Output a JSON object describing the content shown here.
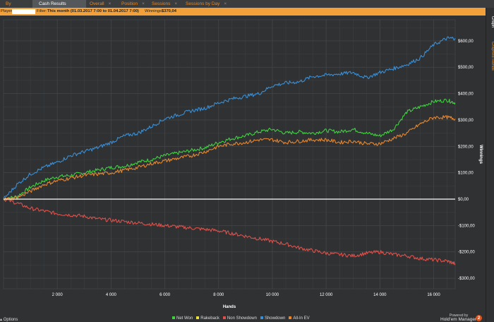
{
  "tabs": [
    {
      "label": "By Stakes",
      "active": false
    },
    {
      "label": "Cash Results Graph",
      "active": true
    },
    {
      "label": "Overall",
      "active": false
    },
    {
      "label": "Position",
      "active": false
    },
    {
      "label": "Sessions",
      "active": false
    },
    {
      "label": "Sessions by Day",
      "active": false
    }
  ],
  "tab_close_glyph": "×",
  "filter": {
    "player_label": "Player:",
    "player_value": "",
    "filter_label": "Filter:",
    "filter_value": "This month (01.03.2017 7:00 to 01.04.2017 7:00)",
    "winnings_label": "Winnings:",
    "winnings_value": "$370,04"
  },
  "sidebar": {
    "graph_label": "Graph",
    "graphed_hands_label": "Graphed Hands"
  },
  "footer": {
    "options_label": "Options",
    "powered_by": "Powered by",
    "brand": "Hold'em Manager",
    "brand_logo": "2"
  },
  "colors": {
    "background": "#2f3133",
    "grid": "#434648",
    "zero_line": "#ffffff",
    "accent": "#f2a13a"
  },
  "chart_data": {
    "type": "line",
    "xlabel": "Hands",
    "ylabel": "Winnings",
    "xlim": [
      0,
      16800
    ],
    "ylim": [
      -340,
      680
    ],
    "x_ticks": [
      {
        "v": 2000,
        "label": "2 000"
      },
      {
        "v": 4000,
        "label": "4 000"
      },
      {
        "v": 6000,
        "label": "6 000"
      },
      {
        "v": 8000,
        "label": "8 000"
      },
      {
        "v": 10000,
        "label": "10 000"
      },
      {
        "v": 12000,
        "label": "12 000"
      },
      {
        "v": 14000,
        "label": "14 000"
      },
      {
        "v": 16000,
        "label": "16 000"
      }
    ],
    "y_ticks": [
      {
        "v": 600,
        "label": "$600,00"
      },
      {
        "v": 500,
        "label": "$500,00"
      },
      {
        "v": 400,
        "label": "$400,00"
      },
      {
        "v": 300,
        "label": "$300,00"
      },
      {
        "v": 200,
        "label": "$200,00"
      },
      {
        "v": 100,
        "label": "$100,00"
      },
      {
        "v": 0,
        "label": "$0,00"
      },
      {
        "v": -100,
        "label": "-$100,00"
      },
      {
        "v": -200,
        "label": "-$200,00"
      },
      {
        "v": -300,
        "label": "-$300,00"
      }
    ],
    "series": [
      {
        "name": "Net Won",
        "color": "#3fd13f",
        "x": [
          0,
          500,
          1000,
          1500,
          2000,
          2500,
          3000,
          3500,
          4000,
          4500,
          5000,
          5500,
          6000,
          6500,
          7000,
          7500,
          8000,
          8500,
          9000,
          9500,
          10000,
          10500,
          11000,
          11500,
          12000,
          12500,
          13000,
          13500,
          14000,
          14500,
          15000,
          15500,
          16000,
          16500,
          16800
        ],
        "y": [
          0,
          10,
          45,
          70,
          85,
          90,
          100,
          110,
          120,
          125,
          140,
          150,
          165,
          175,
          185,
          195,
          215,
          230,
          240,
          255,
          265,
          250,
          255,
          250,
          260,
          255,
          265,
          250,
          240,
          265,
          330,
          350,
          370,
          375,
          365
        ]
      },
      {
        "name": "Rakeback",
        "color": "#e8e23a",
        "x": [
          0,
          16800
        ],
        "y": [
          0,
          0
        ]
      },
      {
        "name": "Non Showdown",
        "color": "#e0504a",
        "x": [
          0,
          500,
          1000,
          1500,
          2000,
          2500,
          3000,
          3500,
          4000,
          4500,
          5000,
          5500,
          6000,
          6500,
          7000,
          7500,
          8000,
          8500,
          9000,
          9500,
          10000,
          10500,
          11000,
          11500,
          12000,
          12500,
          13000,
          13500,
          14000,
          14500,
          15000,
          15500,
          16000,
          16500,
          16800
        ],
        "y": [
          0,
          -15,
          -35,
          -45,
          -55,
          -60,
          -65,
          -75,
          -80,
          -85,
          -90,
          -95,
          -100,
          -105,
          -110,
          -115,
          -120,
          -130,
          -140,
          -150,
          -160,
          -170,
          -185,
          -195,
          -205,
          -210,
          -215,
          -205,
          -200,
          -210,
          -215,
          -225,
          -230,
          -235,
          -245
        ]
      },
      {
        "name": "Showdown",
        "color": "#3a8fd6",
        "x": [
          0,
          500,
          1000,
          1500,
          2000,
          2500,
          3000,
          3500,
          4000,
          4500,
          5000,
          5500,
          6000,
          6500,
          7000,
          7500,
          8000,
          8500,
          9000,
          9500,
          10000,
          10500,
          11000,
          11500,
          12000,
          12500,
          13000,
          13500,
          14000,
          14500,
          15000,
          15500,
          16000,
          16500,
          16800
        ],
        "y": [
          0,
          55,
          95,
          120,
          140,
          165,
          180,
          195,
          215,
          240,
          250,
          275,
          305,
          320,
          335,
          345,
          365,
          380,
          390,
          400,
          430,
          440,
          445,
          465,
          470,
          475,
          480,
          460,
          480,
          495,
          510,
          535,
          585,
          610,
          610
        ]
      },
      {
        "name": "All-In EV",
        "color": "#e7862e",
        "x": [
          0,
          500,
          1000,
          1500,
          2000,
          2500,
          3000,
          3500,
          4000,
          4500,
          5000,
          5500,
          6000,
          6500,
          7000,
          7500,
          8000,
          8500,
          9000,
          9500,
          10000,
          10500,
          11000,
          11500,
          12000,
          12500,
          13000,
          13500,
          14000,
          14500,
          15000,
          15500,
          16000,
          16500,
          16800
        ],
        "y": [
          0,
          5,
          30,
          55,
          70,
          80,
          90,
          95,
          100,
          110,
          120,
          135,
          145,
          155,
          165,
          180,
          200,
          210,
          215,
          225,
          225,
          215,
          220,
          225,
          225,
          215,
          220,
          210,
          210,
          230,
          250,
          285,
          310,
          310,
          305
        ]
      }
    ]
  }
}
